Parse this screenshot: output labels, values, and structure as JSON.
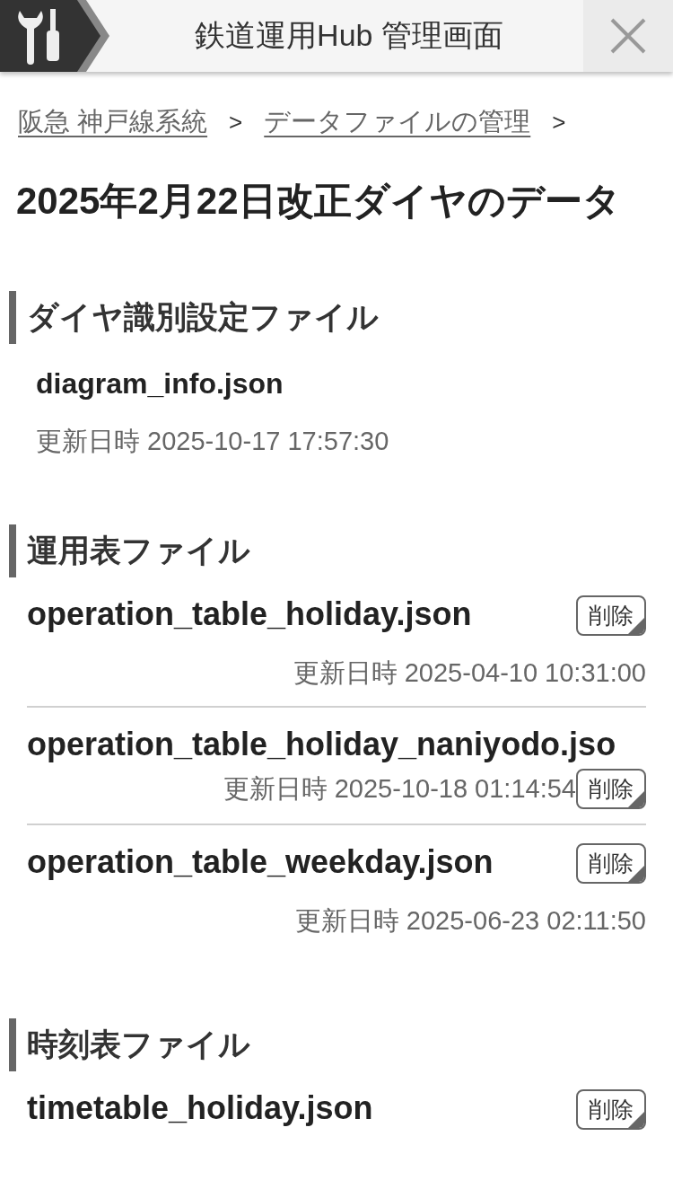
{
  "header": {
    "title": "鉄道運用Hub 管理画面"
  },
  "breadcrumb": [
    {
      "label": "阪急 神戸線系統",
      "kind": "link"
    },
    {
      "label": ">",
      "kind": "separator"
    },
    {
      "label": "データファイルの管理",
      "kind": "link"
    },
    {
      "label": ">",
      "kind": "separator"
    }
  ],
  "page_title": "2025年2月22日改正ダイヤのデータ",
  "sections": [
    {
      "heading": "ダイヤ識別設定ファイル",
      "files": [
        {
          "kind": "info",
          "name": "diagram_info.json",
          "updated": "更新日時 2025-10-17 17:57:30"
        }
      ]
    },
    {
      "heading": "運用表ファイル",
      "files": [
        {
          "kind": "normal",
          "name": "operation_table_holiday.json",
          "delete_button": "削除",
          "updated": "更新日時 2025-04-10 10:31:00"
        },
        {
          "kind": "overflow",
          "name": "operation_table_holiday_naniyodo.jso",
          "delete_button": "削除",
          "updated": "更新日時 2025-10-18 01:14:54"
        },
        {
          "kind": "normal",
          "name": "operation_table_weekday.json",
          "delete_button": "削除",
          "updated": "更新日時 2025-06-23 02:11:50"
        }
      ]
    },
    {
      "heading": "時刻表ファイル",
      "files": [
        {
          "kind": "normal",
          "name": "timetable_holiday.json",
          "delete_button": "削除"
        }
      ]
    }
  ]
}
